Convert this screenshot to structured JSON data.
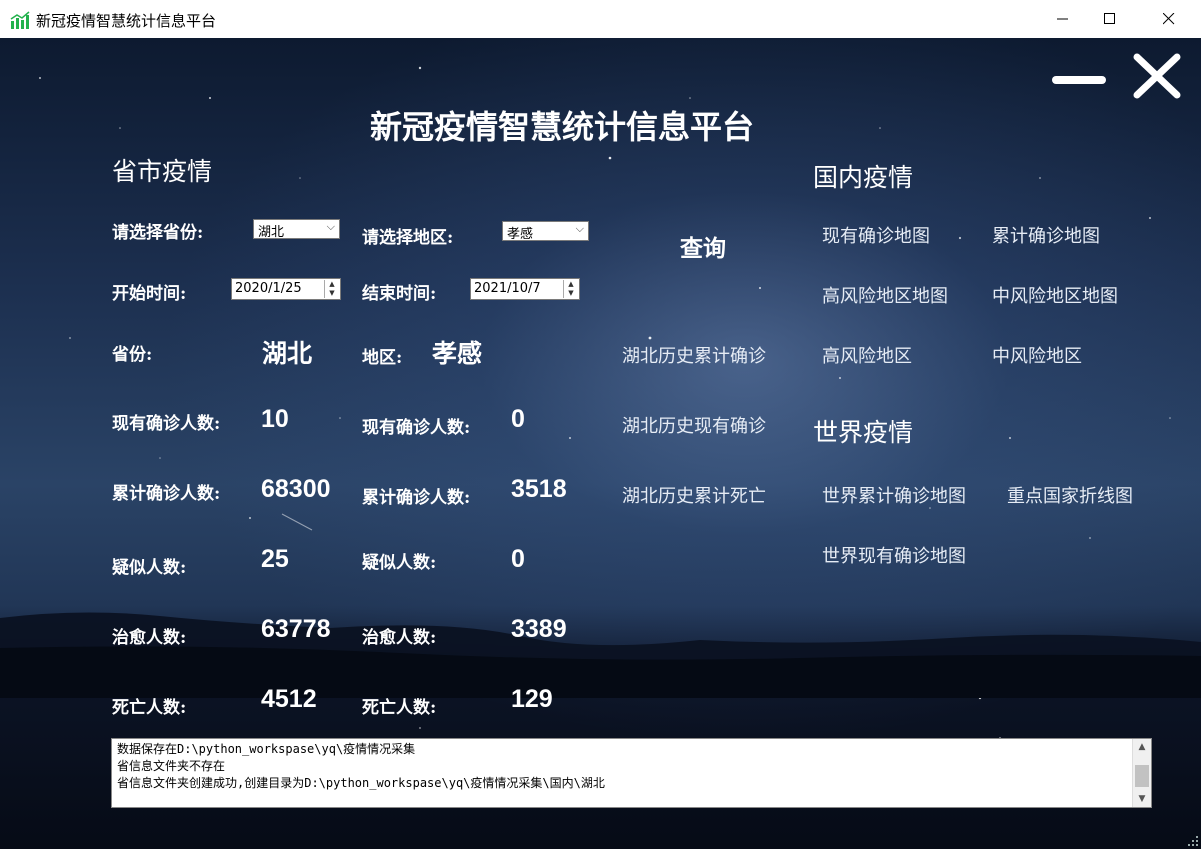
{
  "window": {
    "title": "新冠疫情智慧统计信息平台",
    "min_glyph": "—",
    "max_glyph": "☐",
    "close_glyph": "✕"
  },
  "header": {
    "title": "新冠疫情智慧统计信息平台"
  },
  "province_section": {
    "title": "省市疫情",
    "select_province_label": "请选择省份:",
    "province_value": "湖北",
    "select_region_label": "请选择地区:",
    "region_value": "孝感",
    "start_label": "开始时间:",
    "start_value": "2020/1/25",
    "end_label": "结束时间:",
    "end_value": "2021/10/7",
    "query_button": "查询",
    "province_label": "省份:",
    "province_name": "湖北",
    "region_label": "地区:",
    "region_name": "孝感",
    "current_label": "现有确诊人数:",
    "cumulative_label": "累计确诊人数:",
    "suspected_label": "疑似人数:",
    "cured_label": "治愈人数:",
    "dead_label": "死亡人数:",
    "province_stats": {
      "current": "10",
      "cumulative": "68300",
      "suspected": "25",
      "cured": "63778",
      "dead": "4512"
    },
    "region_stats": {
      "current": "0",
      "cumulative": "3518",
      "suspected": "0",
      "cured": "3389",
      "dead": "129"
    },
    "history_links": [
      "湖北历史累计确诊",
      "湖北历史现有确诊",
      "湖北历史累计死亡"
    ]
  },
  "domestic_section": {
    "title": "国内疫情",
    "links": [
      "现有确诊地图",
      "累计确诊地图",
      "高风险地区地图",
      "中风险地区地图",
      "高风险地区",
      "中风险地区"
    ]
  },
  "world_section": {
    "title": "世界疫情",
    "links": [
      "世界累计确诊地图",
      "重点国家折线图",
      "世界现有确诊地图"
    ]
  },
  "log": {
    "lines": [
      "数据保存在D:\\python_workspase\\yq\\疫情情况采集",
      "省信息文件夹不存在",
      "省信息文件夹创建成功,创建目录为D:\\python_workspase\\yq\\疫情情况采集\\国内\\湖北"
    ]
  }
}
